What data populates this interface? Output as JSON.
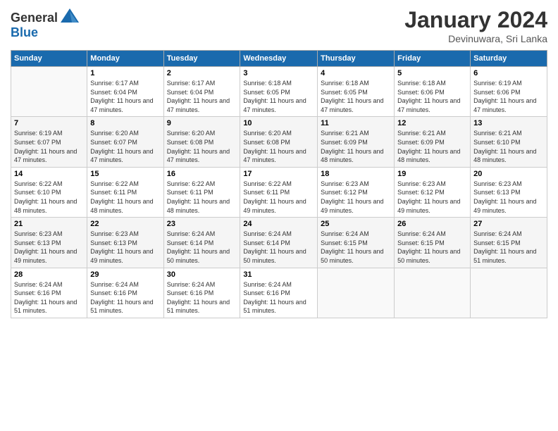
{
  "logo": {
    "general": "General",
    "blue": "Blue"
  },
  "header": {
    "month": "January 2024",
    "location": "Devinuwara, Sri Lanka"
  },
  "days_of_week": [
    "Sunday",
    "Monday",
    "Tuesday",
    "Wednesday",
    "Thursday",
    "Friday",
    "Saturday"
  ],
  "weeks": [
    [
      {
        "num": "",
        "sunrise": "",
        "sunset": "",
        "daylight": ""
      },
      {
        "num": "1",
        "sunrise": "Sunrise: 6:17 AM",
        "sunset": "Sunset: 6:04 PM",
        "daylight": "Daylight: 11 hours and 47 minutes."
      },
      {
        "num": "2",
        "sunrise": "Sunrise: 6:17 AM",
        "sunset": "Sunset: 6:04 PM",
        "daylight": "Daylight: 11 hours and 47 minutes."
      },
      {
        "num": "3",
        "sunrise": "Sunrise: 6:18 AM",
        "sunset": "Sunset: 6:05 PM",
        "daylight": "Daylight: 11 hours and 47 minutes."
      },
      {
        "num": "4",
        "sunrise": "Sunrise: 6:18 AM",
        "sunset": "Sunset: 6:05 PM",
        "daylight": "Daylight: 11 hours and 47 minutes."
      },
      {
        "num": "5",
        "sunrise": "Sunrise: 6:18 AM",
        "sunset": "Sunset: 6:06 PM",
        "daylight": "Daylight: 11 hours and 47 minutes."
      },
      {
        "num": "6",
        "sunrise": "Sunrise: 6:19 AM",
        "sunset": "Sunset: 6:06 PM",
        "daylight": "Daylight: 11 hours and 47 minutes."
      }
    ],
    [
      {
        "num": "7",
        "sunrise": "Sunrise: 6:19 AM",
        "sunset": "Sunset: 6:07 PM",
        "daylight": "Daylight: 11 hours and 47 minutes."
      },
      {
        "num": "8",
        "sunrise": "Sunrise: 6:20 AM",
        "sunset": "Sunset: 6:07 PM",
        "daylight": "Daylight: 11 hours and 47 minutes."
      },
      {
        "num": "9",
        "sunrise": "Sunrise: 6:20 AM",
        "sunset": "Sunset: 6:08 PM",
        "daylight": "Daylight: 11 hours and 47 minutes."
      },
      {
        "num": "10",
        "sunrise": "Sunrise: 6:20 AM",
        "sunset": "Sunset: 6:08 PM",
        "daylight": "Daylight: 11 hours and 47 minutes."
      },
      {
        "num": "11",
        "sunrise": "Sunrise: 6:21 AM",
        "sunset": "Sunset: 6:09 PM",
        "daylight": "Daylight: 11 hours and 48 minutes."
      },
      {
        "num": "12",
        "sunrise": "Sunrise: 6:21 AM",
        "sunset": "Sunset: 6:09 PM",
        "daylight": "Daylight: 11 hours and 48 minutes."
      },
      {
        "num": "13",
        "sunrise": "Sunrise: 6:21 AM",
        "sunset": "Sunset: 6:10 PM",
        "daylight": "Daylight: 11 hours and 48 minutes."
      }
    ],
    [
      {
        "num": "14",
        "sunrise": "Sunrise: 6:22 AM",
        "sunset": "Sunset: 6:10 PM",
        "daylight": "Daylight: 11 hours and 48 minutes."
      },
      {
        "num": "15",
        "sunrise": "Sunrise: 6:22 AM",
        "sunset": "Sunset: 6:11 PM",
        "daylight": "Daylight: 11 hours and 48 minutes."
      },
      {
        "num": "16",
        "sunrise": "Sunrise: 6:22 AM",
        "sunset": "Sunset: 6:11 PM",
        "daylight": "Daylight: 11 hours and 48 minutes."
      },
      {
        "num": "17",
        "sunrise": "Sunrise: 6:22 AM",
        "sunset": "Sunset: 6:11 PM",
        "daylight": "Daylight: 11 hours and 49 minutes."
      },
      {
        "num": "18",
        "sunrise": "Sunrise: 6:23 AM",
        "sunset": "Sunset: 6:12 PM",
        "daylight": "Daylight: 11 hours and 49 minutes."
      },
      {
        "num": "19",
        "sunrise": "Sunrise: 6:23 AM",
        "sunset": "Sunset: 6:12 PM",
        "daylight": "Daylight: 11 hours and 49 minutes."
      },
      {
        "num": "20",
        "sunrise": "Sunrise: 6:23 AM",
        "sunset": "Sunset: 6:13 PM",
        "daylight": "Daylight: 11 hours and 49 minutes."
      }
    ],
    [
      {
        "num": "21",
        "sunrise": "Sunrise: 6:23 AM",
        "sunset": "Sunset: 6:13 PM",
        "daylight": "Daylight: 11 hours and 49 minutes."
      },
      {
        "num": "22",
        "sunrise": "Sunrise: 6:23 AM",
        "sunset": "Sunset: 6:13 PM",
        "daylight": "Daylight: 11 hours and 49 minutes."
      },
      {
        "num": "23",
        "sunrise": "Sunrise: 6:24 AM",
        "sunset": "Sunset: 6:14 PM",
        "daylight": "Daylight: 11 hours and 50 minutes."
      },
      {
        "num": "24",
        "sunrise": "Sunrise: 6:24 AM",
        "sunset": "Sunset: 6:14 PM",
        "daylight": "Daylight: 11 hours and 50 minutes."
      },
      {
        "num": "25",
        "sunrise": "Sunrise: 6:24 AM",
        "sunset": "Sunset: 6:15 PM",
        "daylight": "Daylight: 11 hours and 50 minutes."
      },
      {
        "num": "26",
        "sunrise": "Sunrise: 6:24 AM",
        "sunset": "Sunset: 6:15 PM",
        "daylight": "Daylight: 11 hours and 50 minutes."
      },
      {
        "num": "27",
        "sunrise": "Sunrise: 6:24 AM",
        "sunset": "Sunset: 6:15 PM",
        "daylight": "Daylight: 11 hours and 51 minutes."
      }
    ],
    [
      {
        "num": "28",
        "sunrise": "Sunrise: 6:24 AM",
        "sunset": "Sunset: 6:16 PM",
        "daylight": "Daylight: 11 hours and 51 minutes."
      },
      {
        "num": "29",
        "sunrise": "Sunrise: 6:24 AM",
        "sunset": "Sunset: 6:16 PM",
        "daylight": "Daylight: 11 hours and 51 minutes."
      },
      {
        "num": "30",
        "sunrise": "Sunrise: 6:24 AM",
        "sunset": "Sunset: 6:16 PM",
        "daylight": "Daylight: 11 hours and 51 minutes."
      },
      {
        "num": "31",
        "sunrise": "Sunrise: 6:24 AM",
        "sunset": "Sunset: 6:16 PM",
        "daylight": "Daylight: 11 hours and 51 minutes."
      },
      {
        "num": "",
        "sunrise": "",
        "sunset": "",
        "daylight": ""
      },
      {
        "num": "",
        "sunrise": "",
        "sunset": "",
        "daylight": ""
      },
      {
        "num": "",
        "sunrise": "",
        "sunset": "",
        "daylight": ""
      }
    ]
  ]
}
